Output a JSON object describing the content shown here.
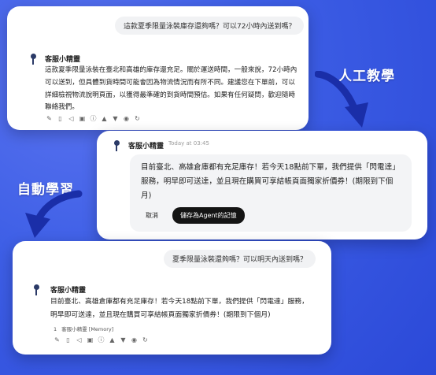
{
  "labels": {
    "human_teach": "人工教學",
    "auto_learn": "自動學習"
  },
  "card1": {
    "user_question": "這款夏季限量泳裝庫存還夠嗎？可以72小時內送到嗎？",
    "bot_name": "客服小精靈",
    "reply_lines": [
      "這款夏季限量泳裝在臺北和高雄的庫存還充足。關於運送時間，一般來說，72小時內",
      "可以送到，但具體到貨時間可能會因為物流情況而有所不同。建議您在下單前，可以",
      "詳細檢視物流說明頁面，以獲得最準確的到貨時間預估。如果有任何疑問，歡迎隨時",
      "聯絡我們。"
    ]
  },
  "card2": {
    "bot_name": "客服小精靈",
    "time": "Today at 03:45",
    "edit_lines": [
      "目前臺北、高雄倉庫都有充足庫存！若今天18點前下單，我們提供「閃電達」",
      "服務，明早即可送達，並且現在購買可享結帳頁面獨家折價券！(期限到下個",
      "月)"
    ],
    "cancel_label": "取消",
    "save_label": "儲存為Agent的記憶"
  },
  "card3": {
    "user_question": "夏季限量泳裝還夠嗎？可以明天內送到嗎？",
    "bot_name": "客服小精靈",
    "reply_lines": [
      "目前臺北、高雄倉庫都有充足庫存！若今天18點前下單，我們提供「閃電達」服務，",
      "明早即可送達，並且現在購買可享結帳頁面獨家折價券！(期限到下個月)"
    ],
    "reference_number": "1",
    "reference_label": "客服小精靈 [Memory]"
  },
  "toolbar_icons": [
    "edit-icon",
    "copy-icon",
    "speaker-icon",
    "image-icon",
    "info-icon",
    "thumbs-up-icon",
    "thumbs-down-icon",
    "stop-icon",
    "regenerate-icon"
  ],
  "colors": {
    "background": "#3e5fe6",
    "card": "#ffffff",
    "save_button": "#141414",
    "arrow": "#1a2ea8"
  }
}
